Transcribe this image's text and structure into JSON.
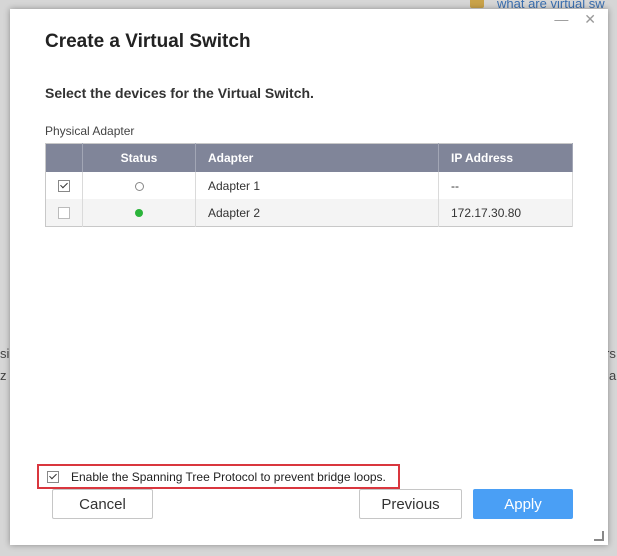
{
  "background": {
    "top_link": "what are virtual sw",
    "left_frag_1": "si",
    "left_frag_2": "z",
    "right_frag_1": "rs",
    "right_frag_2": "a"
  },
  "dialog": {
    "window_controls": "— ✕",
    "title": "Create a Virtual Switch",
    "subtitle": "Select the devices for the Virtual Switch.",
    "section_label": "Physical Adapter",
    "table": {
      "headers": {
        "status": "Status",
        "adapter": "Adapter",
        "ip": "IP Address"
      },
      "rows": [
        {
          "checked": true,
          "status": "offline",
          "adapter": "Adapter 1",
          "ip": "--"
        },
        {
          "checked": false,
          "status": "online",
          "adapter": "Adapter 2",
          "ip": "172.17.30.80"
        }
      ]
    },
    "stp_option": {
      "checked": true,
      "label": "Enable the Spanning Tree Protocol to prevent bridge loops."
    },
    "buttons": {
      "cancel": "Cancel",
      "previous": "Previous",
      "apply": "Apply"
    },
    "colors": {
      "header_bg": "#808599",
      "primary": "#4a9ff5",
      "online": "#2bb43a",
      "highlight": "#d9363e"
    }
  }
}
